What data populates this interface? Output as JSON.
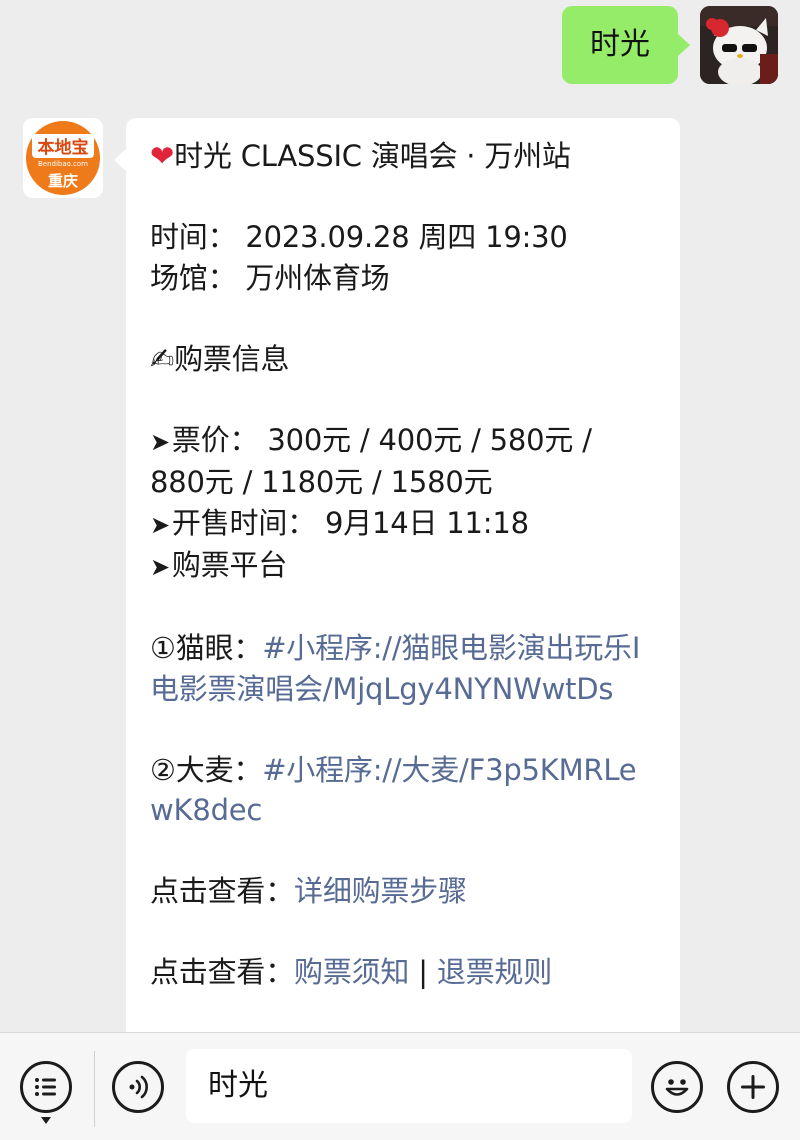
{
  "outgoing": {
    "text": "时光"
  },
  "bot": {
    "logo_top": "本地宝",
    "logo_sub": "Bendibao.com",
    "logo_city": "重庆"
  },
  "message": {
    "title": "时光 CLASSIC 演唱会 · 万州站",
    "time_line": "时间： 2023.09.28 周四 19:30",
    "venue_line": "场馆： 万州体育场",
    "ticket_header_emoji": "✍",
    "ticket_header": "购票信息",
    "arrow": "➤",
    "price_line1": "票价： 300元 / 400元 / 580元 /",
    "price_line2": "880元 / 1180元 / 1580元",
    "sale_time": "开售时间： 9月14日 11:18",
    "platform": "购票平台",
    "maoyan_label": "①猫眼：",
    "maoyan_link": "#小程序://猫眼电影演出玩乐I电影票演唱会/MjqLgy4NYNWwtDs",
    "damai_label": "②大麦：",
    "damai_link": "#小程序://大麦/F3p5KMRLewK8dec",
    "click_view_1": "点击查看：",
    "detail_steps_link": "详细购票步骤",
    "click_view_2": "点击查看：",
    "notice_link": "购票须知",
    "separator": " | ",
    "refund_link": "退票规则"
  },
  "input_bar": {
    "text": "时光"
  }
}
